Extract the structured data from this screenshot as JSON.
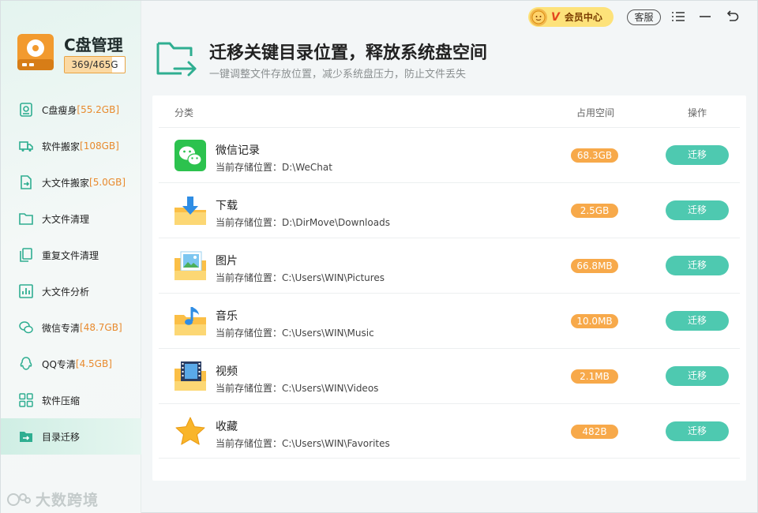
{
  "app": {
    "title": "C盘管理",
    "capacity": "369/465G",
    "capacity_used_fraction": 0.79
  },
  "sidebar": {
    "items": [
      {
        "label": "C盘瘦身",
        "size": "[55.2GB]",
        "icon": "disk-slim-icon"
      },
      {
        "label": "软件搬家",
        "size": "[108GB]",
        "icon": "truck-icon"
      },
      {
        "label": "大文件搬家",
        "size": "[5.0GB]",
        "icon": "file-move-icon"
      },
      {
        "label": "大文件清理",
        "size": "",
        "icon": "folder-icon"
      },
      {
        "label": "重复文件清理",
        "size": "",
        "icon": "duplicate-icon"
      },
      {
        "label": "大文件分析",
        "size": "",
        "icon": "chart-icon"
      },
      {
        "label": "微信专清",
        "size": "[48.7GB]",
        "icon": "wechat-icon"
      },
      {
        "label": "QQ专清",
        "size": "[4.5GB]",
        "icon": "qq-icon"
      },
      {
        "label": "软件压缩",
        "size": "",
        "icon": "grid-icon"
      },
      {
        "label": "目录迁移",
        "size": "",
        "icon": "folder-arrow-icon"
      }
    ],
    "active_index": 9
  },
  "watermark": "大数跨境",
  "topbar": {
    "vip_label": "会员中心",
    "vip_letter": "V",
    "service_label": "客服"
  },
  "header": {
    "title": "迁移关键目录位置，释放系统盘空间",
    "subtitle": "一键调整文件存放位置，减少系统盘压力，防止文件丢失"
  },
  "table": {
    "col_category": "分类",
    "col_space": "占用空间",
    "col_action": "操作",
    "path_prefix": "当前存储位置：",
    "rows": [
      {
        "name": "微信记录",
        "path": "当前存储位置：D:\\WeChat",
        "size": "68.3GB",
        "action": "迁移",
        "icon": "wechat-icon"
      },
      {
        "name": "下载",
        "path": "当前存储位置：D:\\DirMove\\Downloads",
        "size": "2.5GB",
        "action": "迁移",
        "icon": "download-folder-icon"
      },
      {
        "name": "图片",
        "path": "当前存储位置：C:\\Users\\WIN\\Pictures",
        "size": "66.8MB",
        "action": "迁移",
        "icon": "picture-folder-icon"
      },
      {
        "name": "音乐",
        "path": "当前存储位置：C:\\Users\\WIN\\Music",
        "size": "10.0MB",
        "action": "迁移",
        "icon": "music-folder-icon"
      },
      {
        "name": "视频",
        "path": "当前存储位置：C:\\Users\\WIN\\Videos",
        "size": "2.1MB",
        "action": "迁移",
        "icon": "video-folder-icon"
      },
      {
        "name": "收藏",
        "path": "当前存储位置：C:\\Users\\WIN\\Favorites",
        "size": "482B",
        "action": "迁移",
        "icon": "star-icon"
      }
    ]
  },
  "colors": {
    "accent": "#4ec9b0",
    "badge": "#f7a94a",
    "size_text": "#e88a2d"
  }
}
